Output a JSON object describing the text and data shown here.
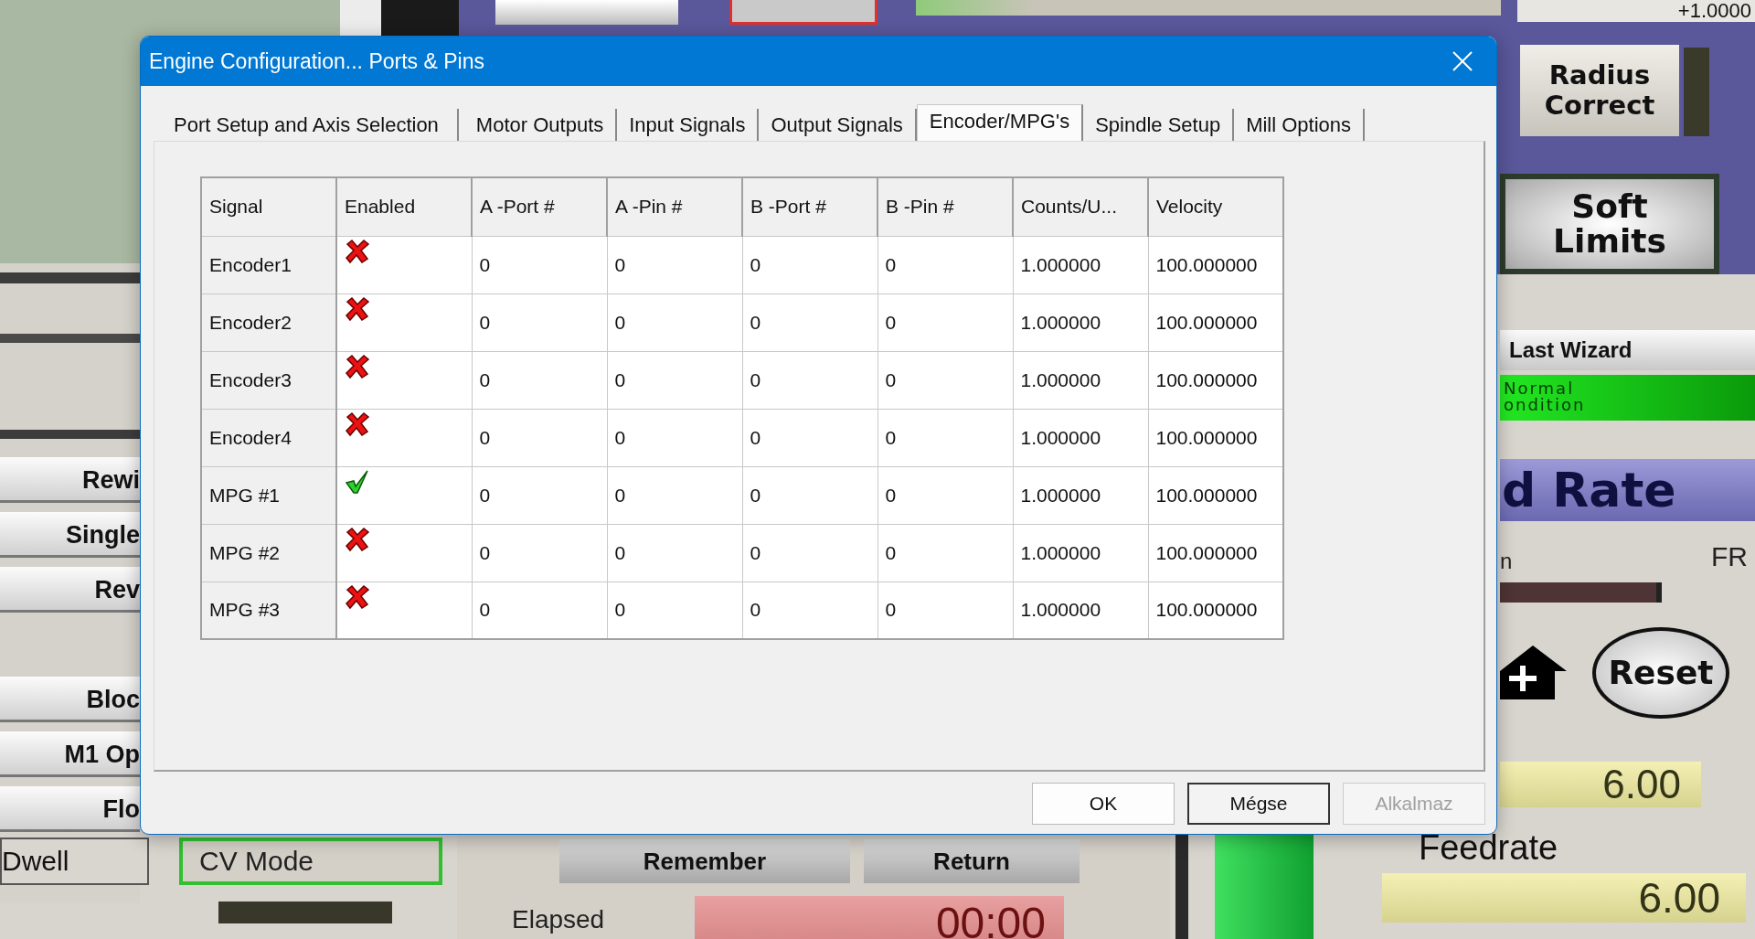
{
  "background": {
    "top_readout": "+1.0000",
    "radius_correct_button": "Radius Correct",
    "soft_limits_button": "Soft Limits",
    "last_wizard_button": "Last Wizard",
    "condition_indicator": "Normal ondition",
    "feed_rate_banner": "d Rate",
    "label_n": "n",
    "label_fr": "FR",
    "reset_button": "Reset",
    "feed_readout": "6.00",
    "feedrate_label": "Feedrate",
    "feedrate_readout": "6.00",
    "left_buttons": [
      "Rewi",
      "Single",
      "Rev",
      "Bloc",
      "M1 Op",
      "Flo"
    ],
    "dwell_button": "Dwell",
    "cv_mode_button": "CV Mode",
    "remember_button": "Remember",
    "return_button": "Return",
    "elapsed_label": "Elapsed",
    "elapsed_readout": "00:00"
  },
  "window": {
    "title": "Engine Configuration... Ports & Pins"
  },
  "tabs": [
    {
      "label": "Port Setup and Axis Selection",
      "selected": false
    },
    {
      "label": "Motor Outputs",
      "selected": false
    },
    {
      "label": "Input Signals",
      "selected": false
    },
    {
      "label": "Output Signals",
      "selected": false
    },
    {
      "label": "Encoder/MPG's",
      "selected": true
    },
    {
      "label": "Spindle Setup",
      "selected": false
    },
    {
      "label": "Mill Options",
      "selected": false
    }
  ],
  "table": {
    "columns": [
      "Signal",
      "Enabled",
      "A -Port #",
      "A -Pin  #",
      "B -Port #",
      "B -Pin  #",
      "Counts/U...",
      "Velocity"
    ],
    "rows": [
      {
        "signal": "Encoder1",
        "enabled": false,
        "a_port": "0",
        "a_pin": "0",
        "b_port": "0",
        "b_pin": "0",
        "counts": "1.000000",
        "velocity": "100.000000"
      },
      {
        "signal": "Encoder2",
        "enabled": false,
        "a_port": "0",
        "a_pin": "0",
        "b_port": "0",
        "b_pin": "0",
        "counts": "1.000000",
        "velocity": "100.000000"
      },
      {
        "signal": "Encoder3",
        "enabled": false,
        "a_port": "0",
        "a_pin": "0",
        "b_port": "0",
        "b_pin": "0",
        "counts": "1.000000",
        "velocity": "100.000000"
      },
      {
        "signal": "Encoder4",
        "enabled": false,
        "a_port": "0",
        "a_pin": "0",
        "b_port": "0",
        "b_pin": "0",
        "counts": "1.000000",
        "velocity": "100.000000"
      },
      {
        "signal": "MPG #1",
        "enabled": true,
        "a_port": "0",
        "a_pin": "0",
        "b_port": "0",
        "b_pin": "0",
        "counts": "1.000000",
        "velocity": "100.000000"
      },
      {
        "signal": "MPG #2",
        "enabled": false,
        "a_port": "0",
        "a_pin": "0",
        "b_port": "0",
        "b_pin": "0",
        "counts": "1.000000",
        "velocity": "100.000000"
      },
      {
        "signal": "MPG #3",
        "enabled": false,
        "a_port": "0",
        "a_pin": "0",
        "b_port": "0",
        "b_pin": "0",
        "counts": "1.000000",
        "velocity": "100.000000"
      }
    ]
  },
  "buttons": [
    {
      "label": "OK",
      "disabled": false,
      "default": false
    },
    {
      "label": "Mégse",
      "disabled": false,
      "default": true
    },
    {
      "label": "Alkalmaz",
      "disabled": true,
      "default": false
    }
  ]
}
